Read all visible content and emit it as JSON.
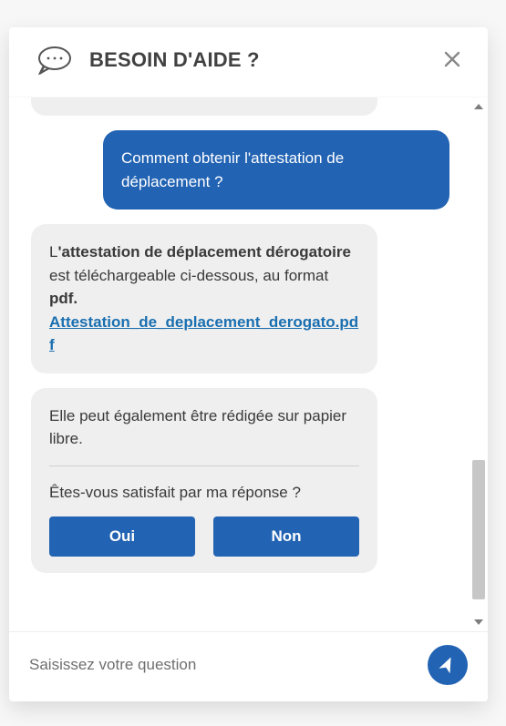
{
  "header": {
    "title": "BESOIN D'AIDE ?"
  },
  "messages": {
    "user1": "Comment obtenir l'attestation de déplacement ?",
    "bot1": {
      "text_pre": "L",
      "text_bold1": "'attestation de déplacement dérogatoire",
      "text_mid": " est téléchargeable ci-dessous, au format ",
      "text_bold2": "pdf.",
      "link_label": "Attestation_de_deplacement_derogato.pdf"
    },
    "bot2": {
      "line1": "Elle peut également être rédigée sur papier libre.",
      "question": "Êtes-vous satisfait par ma réponse ?",
      "yes": "Oui",
      "no": "Non"
    }
  },
  "composer": {
    "placeholder": "Saisissez votre question"
  }
}
